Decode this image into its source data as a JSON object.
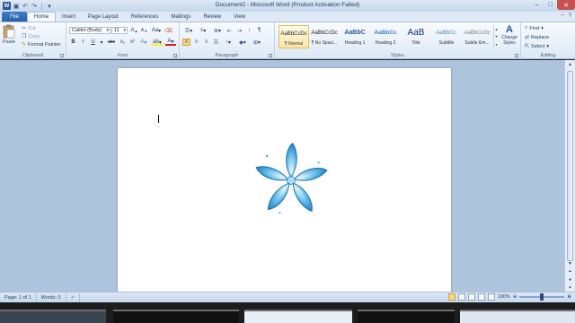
{
  "window": {
    "title": "Document2 - Microsoft Word (Product Activation Failed)",
    "app_logo": "W",
    "controls": {
      "minimize": "–",
      "maximize": "□",
      "close": "✕"
    }
  },
  "quick_access": [
    "save-icon",
    "undo-icon",
    "redo-icon",
    "customize-icon"
  ],
  "tabs": [
    {
      "label": "File",
      "active": false
    },
    {
      "label": "Home",
      "active": true
    },
    {
      "label": "Insert",
      "active": false
    },
    {
      "label": "Page Layout",
      "active": false
    },
    {
      "label": "References",
      "active": false
    },
    {
      "label": "Mailings",
      "active": false
    },
    {
      "label": "Review",
      "active": false
    },
    {
      "label": "View",
      "active": false
    }
  ],
  "ribbon": {
    "clipboard": {
      "label": "Clipboard",
      "paste": "Paste",
      "cut": "Cut",
      "copy": "Copy",
      "format_painter": "Format Painter"
    },
    "font": {
      "label": "Font",
      "font_name": "Calibri (Body)",
      "font_size": "11",
      "grow": "A",
      "shrink": "A",
      "change_case": "Aa",
      "bold": "B",
      "italic": "I",
      "underline": "U",
      "strike": "abc",
      "subscript": "x₂",
      "superscript": "x²",
      "text_effects": "A",
      "highlight": "ab",
      "font_color": "A"
    },
    "paragraph": {
      "label": "Paragraph",
      "show_marks": "¶"
    },
    "styles": {
      "label": "Styles",
      "items": [
        {
          "sample": "AaBbCcDc",
          "name": "¶ Normal",
          "active": true
        },
        {
          "sample": "AaBbCcDc",
          "name": "¶ No Spaci...",
          "active": false
        },
        {
          "sample": "AaBbC",
          "name": "Heading 1",
          "active": false
        },
        {
          "sample": "AaBbCc",
          "name": "Heading 2",
          "active": false
        },
        {
          "sample": "AaB",
          "name": "Title",
          "active": false
        },
        {
          "sample": "AaBbCc.",
          "name": "Subtitle",
          "active": false
        },
        {
          "sample": "AaBbCcDc",
          "name": "Subtle Em...",
          "active": false
        }
      ],
      "change_styles": "Change Styles"
    },
    "editing": {
      "label": "Editing",
      "find": "Find",
      "replace": "Replace",
      "select": "Select"
    }
  },
  "status": {
    "page": "Page: 1 of 1",
    "words": "Words: 0",
    "zoom": "100%",
    "zoom_value": 100
  },
  "colors": {
    "file_tab": "#2a5fa8",
    "ribbon_bg": "#dde8f5",
    "doc_bg": "#aec3dc",
    "flower": "#3aa0d8"
  }
}
